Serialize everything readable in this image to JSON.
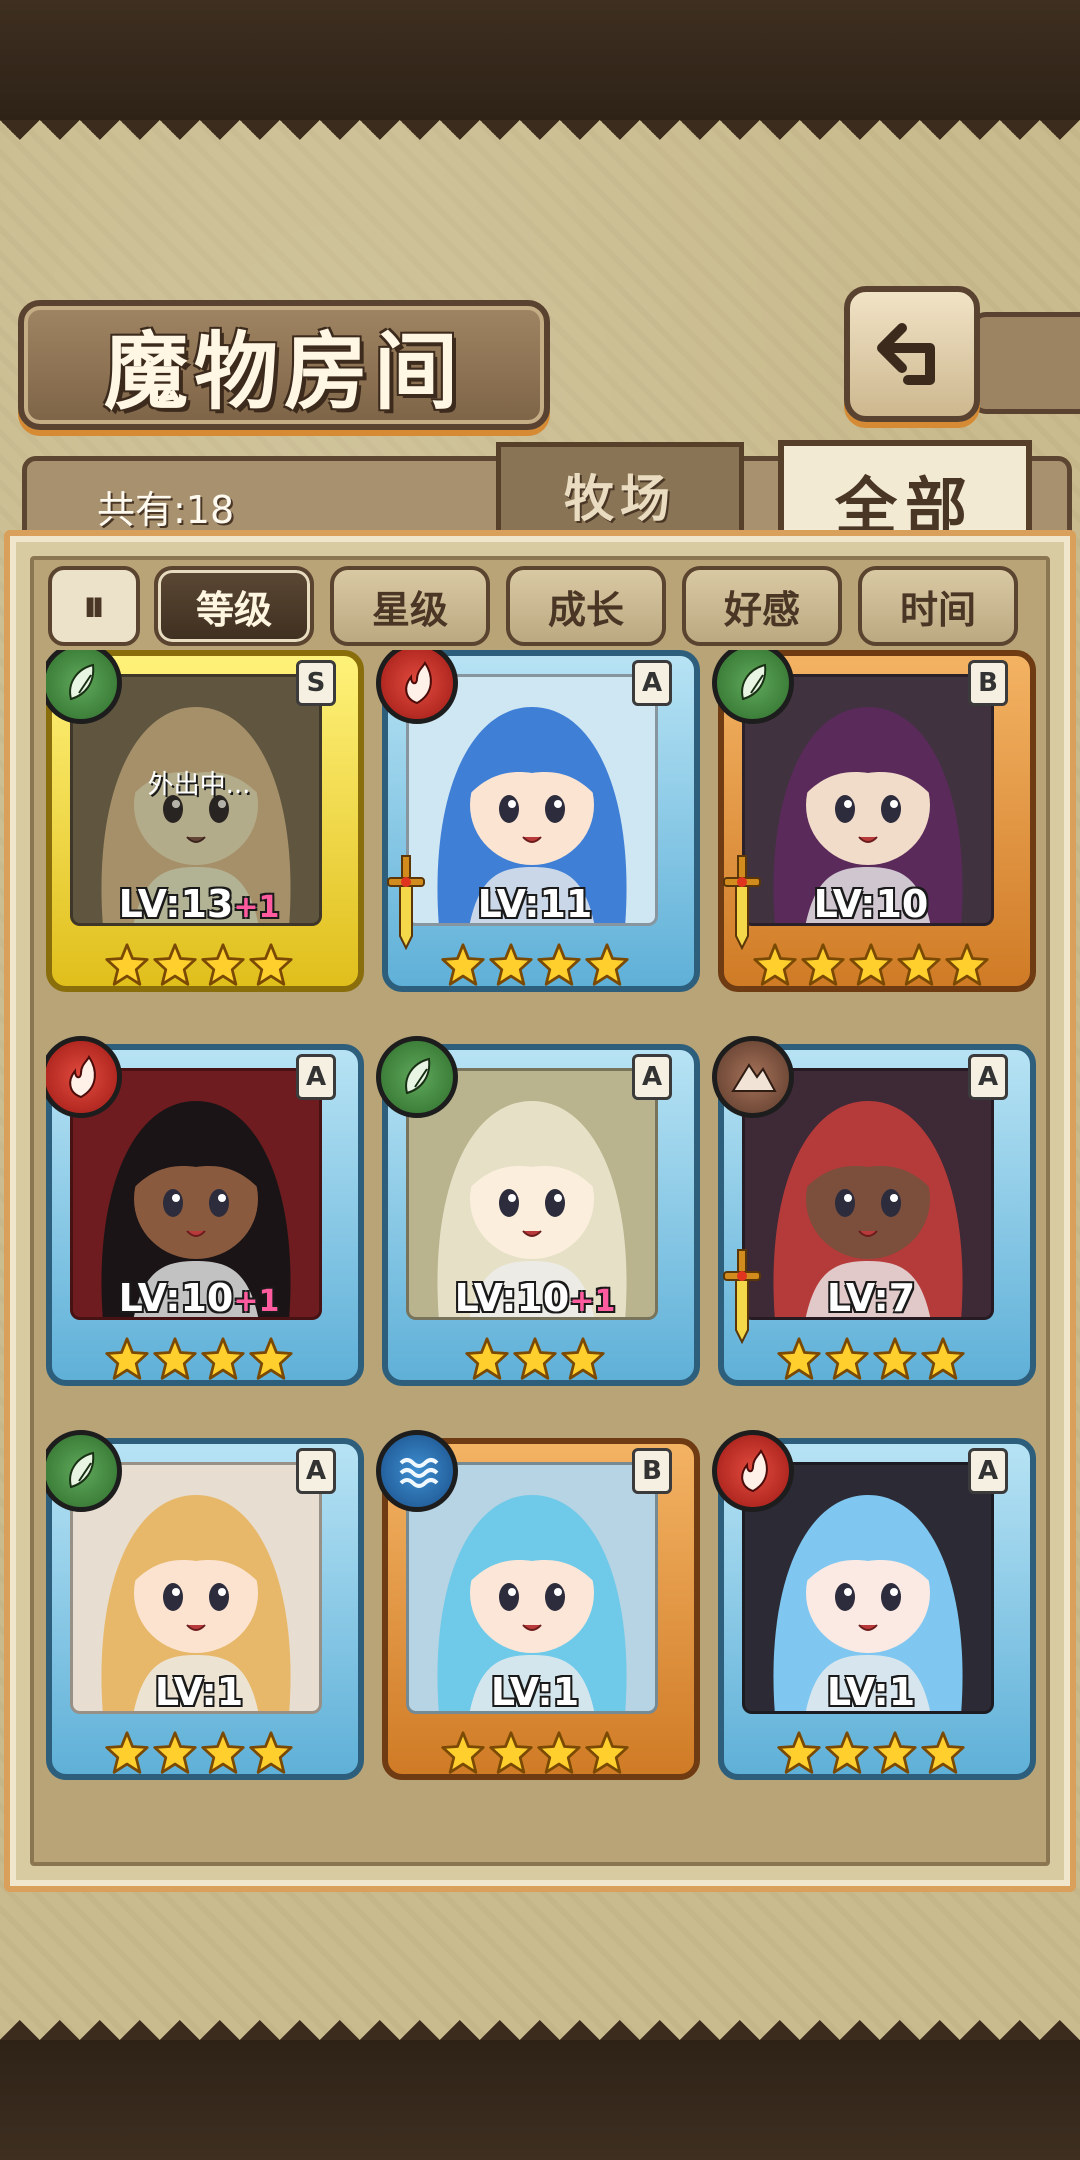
{
  "header": {
    "title": "魔物房间"
  },
  "tabs": {
    "count_label": "共有:18",
    "pasture_label": "牧场",
    "all_label": "全部"
  },
  "filters": {
    "sort_toggle": "⏸",
    "items": [
      {
        "label": "等级",
        "active": true
      },
      {
        "label": "星级",
        "active": false
      },
      {
        "label": "成长",
        "active": false
      },
      {
        "label": "好感",
        "active": false
      },
      {
        "label": "时间",
        "active": false
      }
    ]
  },
  "monsters": [
    {
      "level": "LV:13",
      "bonus": "+1",
      "stars": 4,
      "rarity": "S",
      "element": "leaf",
      "weapon": false,
      "status": "外出中...",
      "hair": "#d9b46a",
      "skin": "#f2d4b7",
      "bg": "#7a6a47"
    },
    {
      "level": "LV:11",
      "bonus": "",
      "stars": 4,
      "rarity": "A",
      "element": "fire",
      "weapon": true,
      "status": "",
      "hair": "#3f7fd6",
      "skin": "#fbe4d2",
      "bg": "#cfe6f3"
    },
    {
      "level": "LV:10",
      "bonus": "",
      "stars": 5,
      "rarity": "B",
      "element": "leaf",
      "weapon": true,
      "status": "",
      "hair": "#5a2a5a",
      "skin": "#f1dbc9",
      "bg": "#40323f"
    },
    {
      "level": "LV:10",
      "bonus": "+1",
      "stars": 4,
      "rarity": "A",
      "element": "fire",
      "weapon": false,
      "status": "",
      "hair": "#1b1416",
      "skin": "#8a5a3e",
      "bg": "#6e1c1f"
    },
    {
      "level": "LV:10",
      "bonus": "+1",
      "stars": 3,
      "rarity": "A",
      "element": "leaf",
      "weapon": false,
      "status": "",
      "hair": "#e6e0c6",
      "skin": "#fbeedd",
      "bg": "#b9b38e"
    },
    {
      "level": "LV:7",
      "bonus": "",
      "stars": 4,
      "rarity": "A",
      "element": "earth",
      "weapon": true,
      "status": "",
      "hair": "#b53a3a",
      "skin": "#7b4f3c",
      "bg": "#3d2a36"
    },
    {
      "level": "LV:1",
      "bonus": "",
      "stars": 4,
      "rarity": "A",
      "element": "leaf",
      "weapon": false,
      "status": "",
      "hair": "#e8b86a",
      "skin": "#fbe3d0",
      "bg": "#e7ddd0"
    },
    {
      "level": "LV:1",
      "bonus": "",
      "stars": 4,
      "rarity": "B",
      "element": "water",
      "weapon": false,
      "status": "",
      "hair": "#6fc9e8",
      "skin": "#fbe6d8",
      "bg": "#b6d4e4"
    },
    {
      "level": "LV:1",
      "bonus": "",
      "stars": 4,
      "rarity": "A",
      "element": "fire",
      "weapon": false,
      "status": "",
      "hair": "#7fc7f0",
      "skin": "#fbe9e3",
      "bg": "#2b2a35"
    }
  ]
}
